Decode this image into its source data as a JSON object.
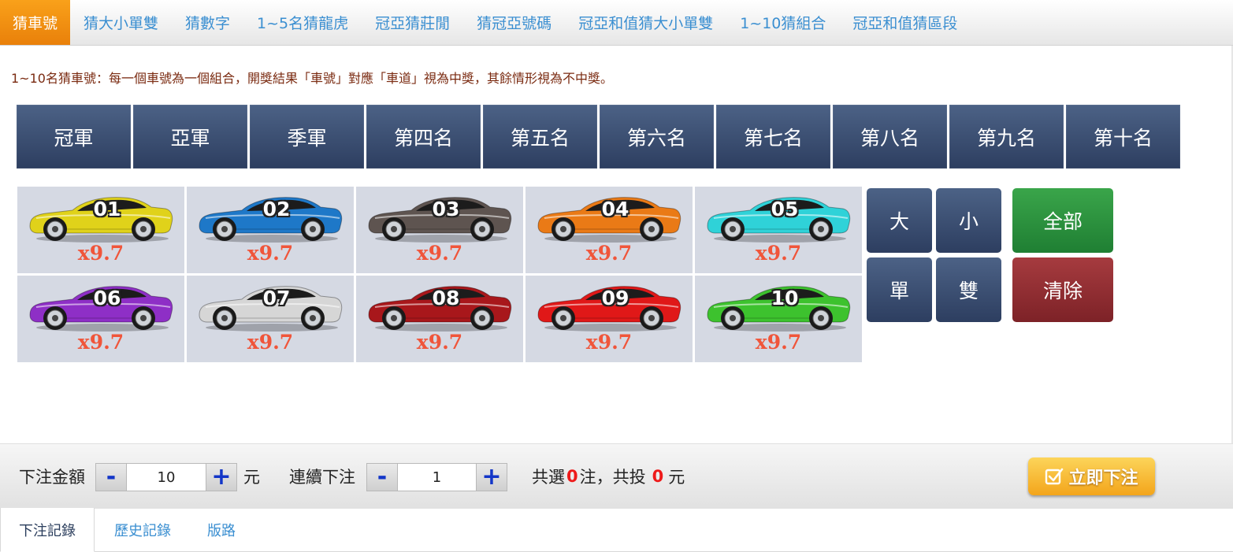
{
  "top_tabs": [
    {
      "label": "猜車號",
      "active": true
    },
    {
      "label": "猜大小單雙"
    },
    {
      "label": "猜數字"
    },
    {
      "label": "1~5名猜龍虎"
    },
    {
      "label": "冠亞猜莊閒"
    },
    {
      "label": "猜冠亞號碼"
    },
    {
      "label": "冠亞和值猜大小單雙"
    },
    {
      "label": "1~10猜組合"
    },
    {
      "label": "冠亞和值猜區段"
    }
  ],
  "description": "1~10名猜車號：每一個車號為一個組合，開獎結果「車號」對應「車道」視為中獎，其餘情形視為不中獎。",
  "ranks": [
    "冠軍",
    "亞軍",
    "季軍",
    "第四名",
    "第五名",
    "第六名",
    "第七名",
    "第八名",
    "第九名",
    "第十名"
  ],
  "cars": [
    {
      "number": "01",
      "odds": "x9.7",
      "color": "#e0d21a"
    },
    {
      "number": "02",
      "odds": "x9.7",
      "color": "#1e78c8"
    },
    {
      "number": "03",
      "odds": "x9.7",
      "color": "#5e5450"
    },
    {
      "number": "04",
      "odds": "x9.7",
      "color": "#ea7a16"
    },
    {
      "number": "05",
      "odds": "x9.7",
      "color": "#2fd2d8"
    },
    {
      "number": "06",
      "odds": "x9.7",
      "color": "#8e2fc6"
    },
    {
      "number": "07",
      "odds": "x9.7",
      "color": "#d6d6d6"
    },
    {
      "number": "08",
      "odds": "x9.7",
      "color": "#a8171b"
    },
    {
      "number": "09",
      "odds": "x9.7",
      "color": "#e01818"
    },
    {
      "number": "10",
      "odds": "x9.7",
      "color": "#3dc22e"
    }
  ],
  "quick": {
    "big": "大",
    "small": "小",
    "odd": "單",
    "even": "雙",
    "all": "全部",
    "clear": "清除"
  },
  "bet": {
    "amount_label": "下注金額",
    "amount_value": "10",
    "unit": "元",
    "continuous_label": "連續下注",
    "continuous_value": "1",
    "minus": "-",
    "plus": "+",
    "summary_prefix": "共選",
    "selected_count": "0",
    "summary_mid": "注，共投",
    "total_amount": "0",
    "summary_suffix": "元",
    "submit_label": "立即下注"
  },
  "bottom_tabs": [
    {
      "label": "下注記錄",
      "active": true
    },
    {
      "label": "歷史記錄"
    },
    {
      "label": "版路"
    }
  ]
}
